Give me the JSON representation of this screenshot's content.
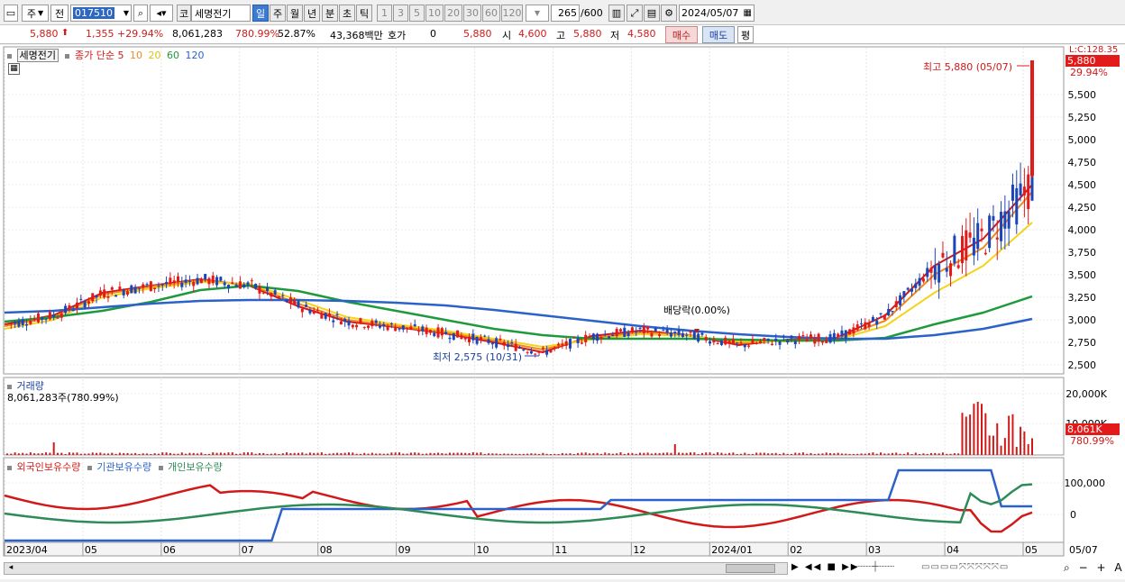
{
  "toolbar": {
    "market_type": "주",
    "prev_label": "전",
    "code": "017510",
    "market_label": "코",
    "stock_name": "세명전기",
    "periods": [
      "일",
      "주",
      "월",
      "년",
      "분",
      "초",
      "틱"
    ],
    "active_period": "일",
    "intervals": [
      "1",
      "3",
      "5",
      "10",
      "20",
      "30",
      "60",
      "120"
    ],
    "count": "265",
    "count_total": "/600",
    "date": "2024/05/07"
  },
  "infobar": {
    "price": "5,880",
    "change": "1,355",
    "change_pct": "+29.94%",
    "volume": "8,061,283",
    "volume_ratio": "780.99%",
    "turnover": "52.87%",
    "amount": "43,368백만",
    "quote_label": "호가",
    "quote_value": "0",
    "quote_price": "5,880",
    "open_label": "시",
    "open": "4,600",
    "high_label": "고",
    "high": "5,880",
    "low_label": "저",
    "low": "4,580",
    "buy_button": "매수",
    "sell_button": "매도",
    "eval_button": "평"
  },
  "price_panel": {
    "legend_name": "세명전기",
    "legend_ma_label": "종가 단순",
    "legend_ma": [
      {
        "period": "5",
        "color": "#d21919"
      },
      {
        "period": "10",
        "color": "#ef8a1f"
      },
      {
        "period": "20",
        "color": "#f5d31c"
      },
      {
        "period": "60",
        "color": "#1e9a3c"
      },
      {
        "period": "120",
        "color": "#2b62c9"
      }
    ],
    "high_annotation": "최고 5,880 (05/07)",
    "low_annotation": "최저 2,575 (10/31)",
    "dividend_annotation": "배당락(0.00%)",
    "corner_label": "L:C:128.35",
    "current_price_tag": "5,880",
    "current_pct_tag": "29.94%",
    "y_ticks": [
      "5,500",
      "5,250",
      "5,000",
      "4,750",
      "4,500",
      "4,250",
      "4,000",
      "3,750",
      "3,500",
      "3,250",
      "3,000",
      "2,750",
      "2,500"
    ]
  },
  "volume_panel": {
    "title": "거래량",
    "value": "8,061,283주(780.99%)",
    "y_ticks": [
      "20,000K",
      "10,000K"
    ],
    "current_tag": "8,061K",
    "current_pct_tag": "780.99%"
  },
  "holdings_panel": {
    "legend": [
      {
        "label": "외국인보유수량",
        "color": "#d21919"
      },
      {
        "label": "기관보유수량",
        "color": "#2b62c9"
      },
      {
        "label": "개인보유수량",
        "color": "#2e8b57"
      }
    ],
    "y_ticks": [
      "100,000",
      "0"
    ]
  },
  "x_axis": {
    "labels": [
      "2023/04",
      "05",
      "06",
      "07",
      "08",
      "09",
      "10",
      "11",
      "12",
      "2024/01",
      "02",
      "03",
      "04",
      "05"
    ],
    "right_label": "05/07"
  },
  "chart_data": {
    "type": "line",
    "series": [
      {
        "name": "5",
        "values": [
          2950,
          3050,
          3300,
          3380,
          3450,
          3380,
          3150,
          2980,
          2920,
          2850,
          2750,
          2640,
          2820,
          2880,
          2830,
          2720,
          2780,
          2800,
          3050,
          3600,
          3900,
          4500
        ]
      },
      {
        "name": "10",
        "values": [
          2930,
          3030,
          3280,
          3370,
          3440,
          3390,
          3180,
          3000,
          2930,
          2860,
          2770,
          2670,
          2800,
          2860,
          2830,
          2740,
          2770,
          2790,
          2990,
          3500,
          3800,
          4420
        ]
      },
      {
        "name": "20",
        "values": [
          2900,
          3000,
          3250,
          3350,
          3420,
          3400,
          3220,
          3030,
          2950,
          2880,
          2790,
          2700,
          2780,
          2840,
          2820,
          2760,
          2760,
          2780,
          2930,
          3300,
          3600,
          4080
        ]
      },
      {
        "name": "60",
        "values": [
          2980,
          3030,
          3100,
          3200,
          3330,
          3380,
          3320,
          3200,
          3100,
          3000,
          2900,
          2830,
          2790,
          2790,
          2790,
          2780,
          2770,
          2770,
          2800,
          2950,
          3080,
          3260
        ]
      },
      {
        "name": "120",
        "values": [
          3080,
          3100,
          3140,
          3180,
          3210,
          3220,
          3220,
          3210,
          3190,
          3160,
          3110,
          3050,
          2990,
          2930,
          2880,
          2840,
          2810,
          2790,
          2790,
          2830,
          2900,
          3010
        ]
      }
    ]
  }
}
